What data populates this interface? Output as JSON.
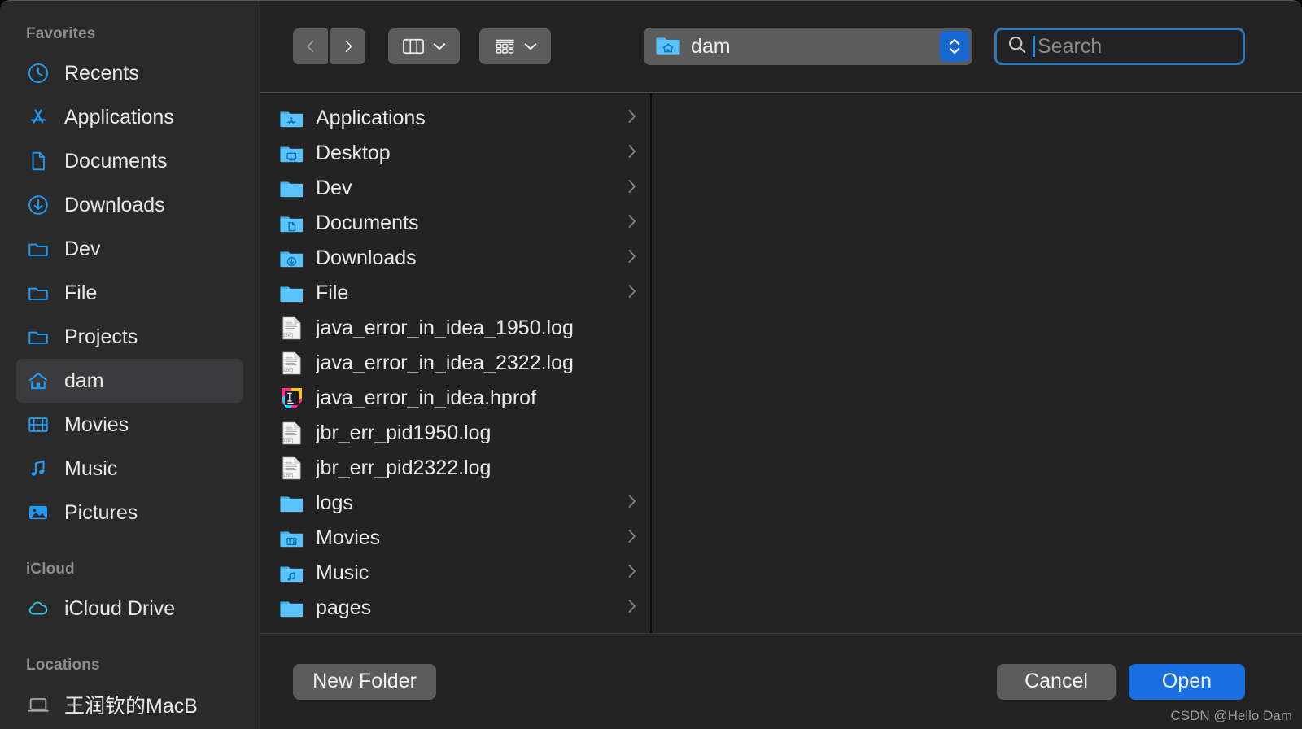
{
  "sidebar": {
    "sections": [
      {
        "title": "Favorites",
        "items": [
          {
            "label": "Recents",
            "icon": "clock-icon",
            "selected": false
          },
          {
            "label": "Applications",
            "icon": "appstore-icon",
            "selected": false
          },
          {
            "label": "Documents",
            "icon": "document-icon",
            "selected": false
          },
          {
            "label": "Downloads",
            "icon": "download-icon",
            "selected": false
          },
          {
            "label": "Dev",
            "icon": "folder-icon",
            "selected": false
          },
          {
            "label": "File",
            "icon": "folder-icon",
            "selected": false
          },
          {
            "label": "Projects",
            "icon": "folder-icon",
            "selected": false
          },
          {
            "label": "dam",
            "icon": "home-icon",
            "selected": true
          },
          {
            "label": "Movies",
            "icon": "film-icon",
            "selected": false
          },
          {
            "label": "Music",
            "icon": "music-note-icon",
            "selected": false
          },
          {
            "label": "Pictures",
            "icon": "photo-icon",
            "selected": false
          }
        ]
      },
      {
        "title": "iCloud",
        "items": [
          {
            "label": "iCloud Drive",
            "icon": "cloud-icon",
            "selected": false
          }
        ]
      },
      {
        "title": "Locations",
        "items": [
          {
            "label": "王润钦的MacB",
            "icon": "laptop-icon",
            "selected": false
          }
        ]
      }
    ]
  },
  "toolbar": {
    "back_label": "Back",
    "forward_label": "Forward",
    "view_mode": "column-view",
    "group_mode": "group-by",
    "path": {
      "label": "dam",
      "icon": "home-folder-icon"
    },
    "search": {
      "placeholder": "Search",
      "value": "",
      "focused": true
    }
  },
  "file_list": [
    {
      "name": "Applications",
      "icon": "folder-applications-icon",
      "has_children": true
    },
    {
      "name": "Desktop",
      "icon": "folder-desktop-icon",
      "has_children": true
    },
    {
      "name": "Dev",
      "icon": "folder-plain-icon",
      "has_children": true
    },
    {
      "name": "Documents",
      "icon": "folder-documents-icon",
      "has_children": true
    },
    {
      "name": "Downloads",
      "icon": "folder-downloads-icon",
      "has_children": true
    },
    {
      "name": "File",
      "icon": "folder-plain-icon",
      "has_children": true
    },
    {
      "name": "java_error_in_idea_1950.log",
      "icon": "log-file-icon",
      "has_children": false
    },
    {
      "name": "java_error_in_idea_2322.log",
      "icon": "log-file-icon",
      "has_children": false
    },
    {
      "name": "java_error_in_idea.hprof",
      "icon": "intellij-file-icon",
      "has_children": false
    },
    {
      "name": "jbr_err_pid1950.log",
      "icon": "log-file-icon",
      "has_children": false
    },
    {
      "name": "jbr_err_pid2322.log",
      "icon": "log-file-icon",
      "has_children": false
    },
    {
      "name": "logs",
      "icon": "folder-plain-icon",
      "has_children": true
    },
    {
      "name": "Movies",
      "icon": "folder-movies-icon",
      "has_children": true
    },
    {
      "name": "Music",
      "icon": "folder-music-icon",
      "has_children": true
    },
    {
      "name": "pages",
      "icon": "folder-plain-icon",
      "has_children": true
    }
  ],
  "footer": {
    "new_folder_label": "New Folder",
    "cancel_label": "Cancel",
    "open_label": "Open"
  },
  "watermark": "CSDN @Hello Dam",
  "colors": {
    "accent_blue": "#1a6fe0",
    "sidebar_icon_blue": "#1d9bf5",
    "window_bg": "#232323",
    "sidebar_bg": "#2a2a2a",
    "selected_row": "#3b3b3d"
  }
}
